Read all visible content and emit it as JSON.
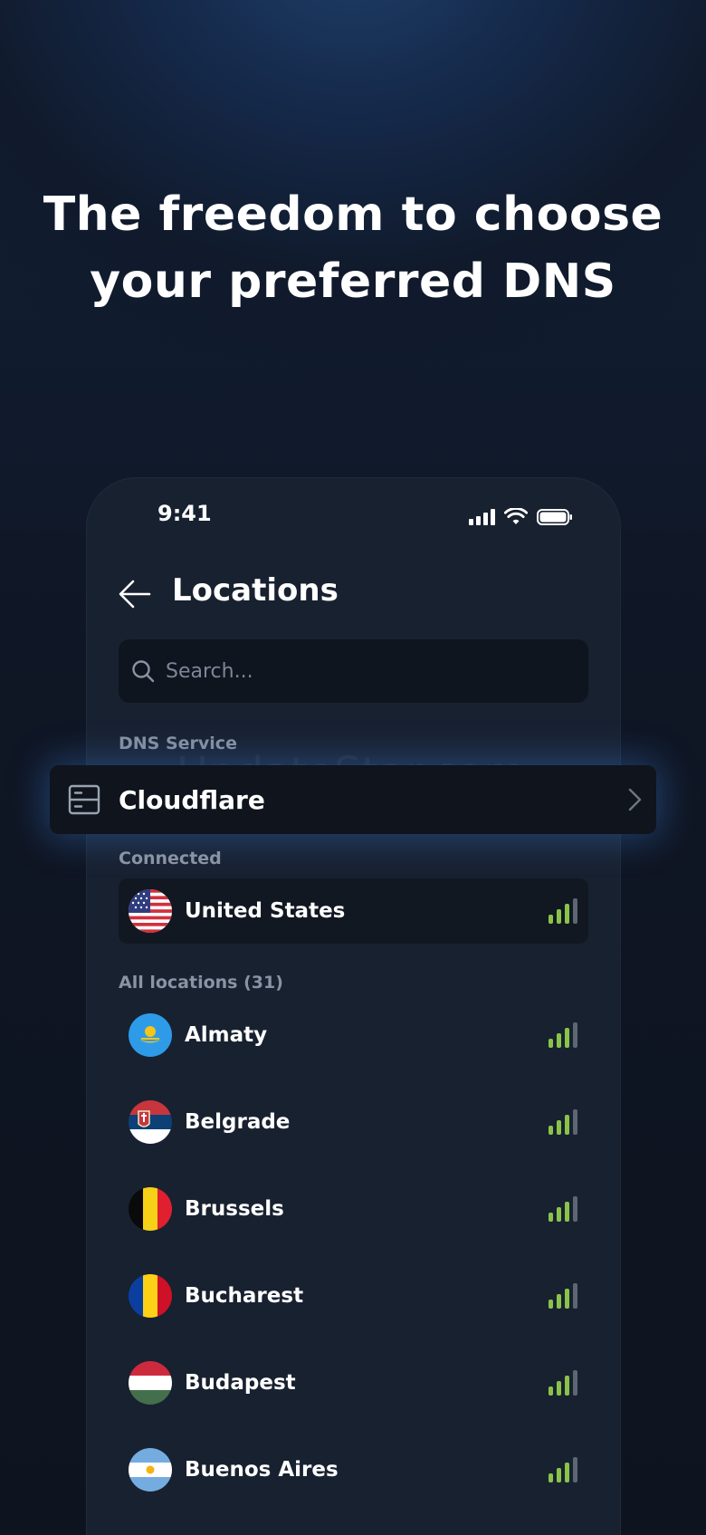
{
  "headline": {
    "line1": "The freedom to choose",
    "line2": "your preferred DNS"
  },
  "status_bar": {
    "time": "9:41",
    "icons": [
      "cellular-signal-icon",
      "wifi-icon",
      "battery-icon"
    ]
  },
  "header": {
    "title": "Locations",
    "back_icon": "arrow-left-icon"
  },
  "search": {
    "placeholder": "Search...",
    "icon": "search-icon"
  },
  "dns": {
    "section_label": "DNS Service",
    "name": "Cloudflare",
    "icon": "server-icon",
    "chevron": "chevron-right-icon",
    "watermark": "UpdateStar.com"
  },
  "connected": {
    "section_label": "Connected",
    "location": "United States",
    "flag": "us"
  },
  "all_locations": {
    "section_label": "All locations (31)",
    "items": [
      {
        "name": "Almaty",
        "flag": "kz"
      },
      {
        "name": "Belgrade",
        "flag": "rs"
      },
      {
        "name": "Brussels",
        "flag": "be"
      },
      {
        "name": "Bucharest",
        "flag": "ro"
      },
      {
        "name": "Budapest",
        "flag": "hu"
      },
      {
        "name": "Buenos Aires",
        "flag": "ar"
      }
    ]
  },
  "colors": {
    "signal_on": "#8bc34a",
    "signal_off": "#5e6573",
    "accent_glow": "#386ebe"
  }
}
